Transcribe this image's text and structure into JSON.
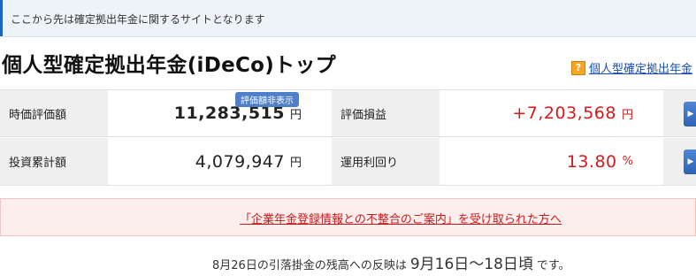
{
  "notice": {
    "text": "ここから先は確定拠出年金に関するサイトとなります"
  },
  "page": {
    "title": "個人型確定拠出年金(iDeCo)トップ",
    "help_icon": "question-mark-icon",
    "help_icon_glyph": "?",
    "help_link": "個人型確定拠出年金"
  },
  "summary": {
    "hide_badge": "評価額非表示",
    "market_value_label": "時価評価額",
    "market_value": "11,283,515",
    "market_value_unit": "円",
    "gain_loss_label": "評価損益",
    "gain_loss": "+7,203,568",
    "gain_loss_unit": "円",
    "contribution_label": "投資累計額",
    "contribution": "4,079,947",
    "contribution_unit": "円",
    "return_label": "運用利回り",
    "return_value": "13.80",
    "return_unit": "%",
    "expand_icon": "triangle-right-icon",
    "expand_glyph": "▶"
  },
  "alert": {
    "link_text": "「企業年金登録情報との不整合のご案内」を受け取られた方へ"
  },
  "reflect": {
    "prefix": "8月26日の引落掛金の残高への反映は",
    "period": "9月16日～18日頃",
    "suffix": "です。"
  },
  "colors": {
    "accent_blue": "#1a66c6",
    "positive_red": "#d41a1a",
    "alert_bg": "#fdeeee"
  }
}
